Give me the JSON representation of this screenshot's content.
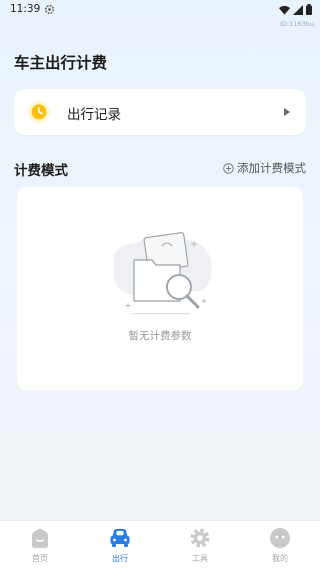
{
  "status": {
    "time": "11:39",
    "speed": "ID:1163bu"
  },
  "page": {
    "title": "车主出行计费"
  },
  "record": {
    "label": "出行记录"
  },
  "billing": {
    "section_title": "计费模式",
    "add_label": "添加计费模式",
    "empty_text": "暂无计费参数"
  },
  "tabs": [
    {
      "label": "首页",
      "icon": "home-icon",
      "active": false
    },
    {
      "label": "出行",
      "icon": "car-icon",
      "active": true
    },
    {
      "label": "工具",
      "icon": "gear-icon",
      "active": false
    },
    {
      "label": "我的",
      "icon": "profile-face-icon",
      "active": false
    }
  ],
  "colors": {
    "accent": "#2a7de1",
    "clock": "#ffc107",
    "background": "#eaf3fc"
  }
}
